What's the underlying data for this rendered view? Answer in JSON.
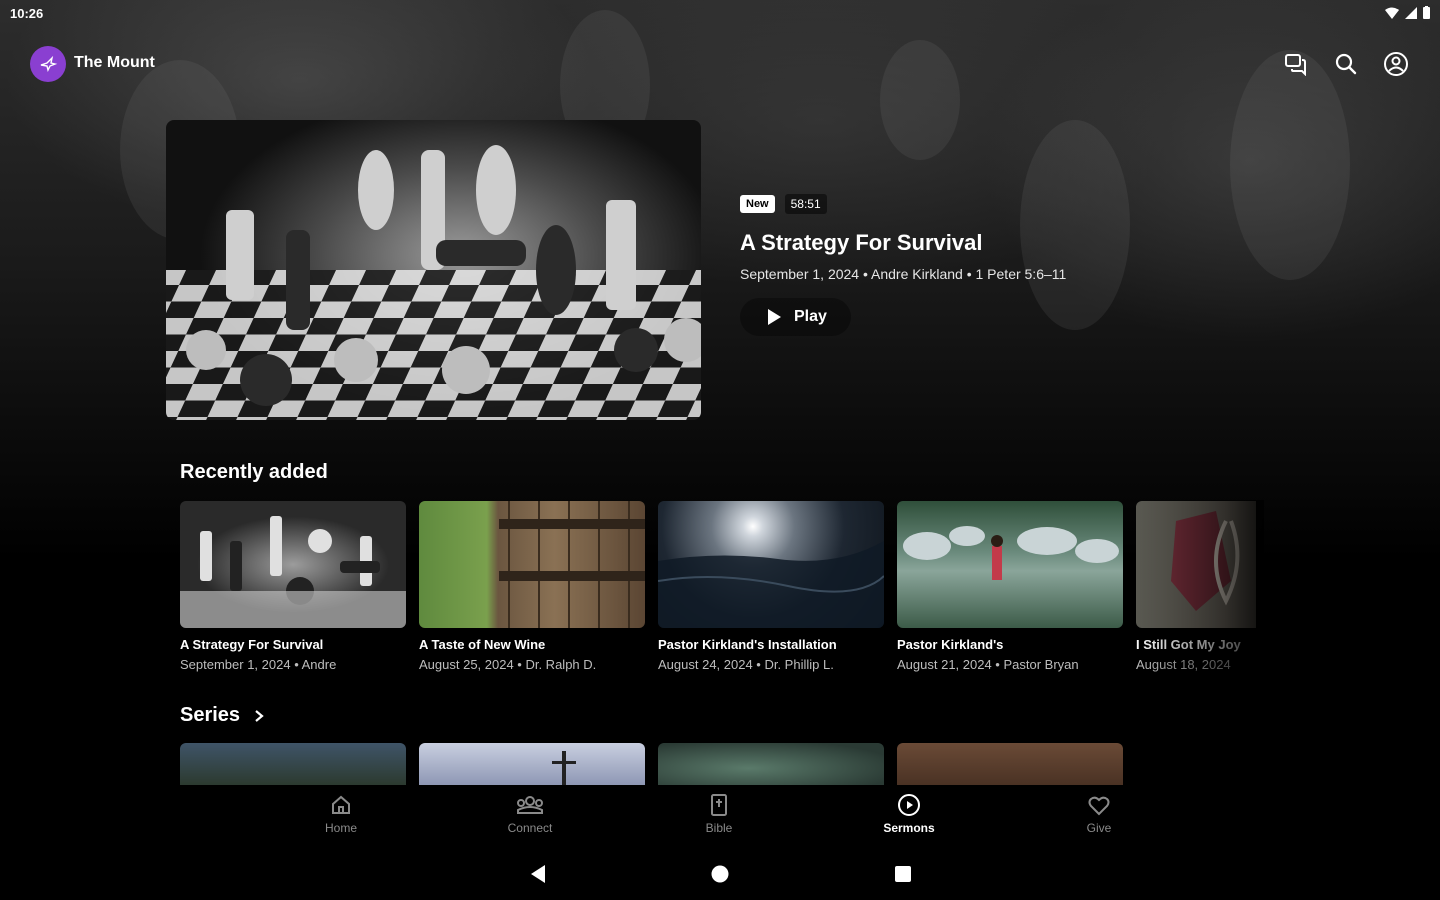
{
  "status": {
    "time": "10:26"
  },
  "app": {
    "title": "The Mount",
    "brand_color": "#8a3fd1"
  },
  "hero": {
    "badge_new": "New",
    "duration": "58:51",
    "title": "A Strategy For Survival",
    "meta": "September 1, 2024 • Andre Kirkland • 1 Peter 5:6–11",
    "play_label": "Play"
  },
  "recent": {
    "title": "Recently added",
    "items": [
      {
        "title": "A Strategy For Survival",
        "sub": "September 1, 2024 • Andre"
      },
      {
        "title": "A Taste of New Wine",
        "sub": "August 25, 2024 • Dr. Ralph D."
      },
      {
        "title": "Pastor Kirkland's Installation",
        "sub": "August 24, 2024 • Dr. Phillip L."
      },
      {
        "title": "Pastor Kirkland's",
        "sub": "August 21, 2024 • Pastor Bryan"
      },
      {
        "title": "I Still Got My Joy",
        "sub": "August 18, 2024"
      }
    ]
  },
  "series": {
    "title": "Series"
  },
  "nav": {
    "items": [
      {
        "label": "Home",
        "icon": "home-icon"
      },
      {
        "label": "Connect",
        "icon": "people-icon"
      },
      {
        "label": "Bible",
        "icon": "bible-icon"
      },
      {
        "label": "Sermons",
        "icon": "play-circle-icon"
      },
      {
        "label": "Give",
        "icon": "heart-icon"
      }
    ],
    "active": "Sermons"
  }
}
